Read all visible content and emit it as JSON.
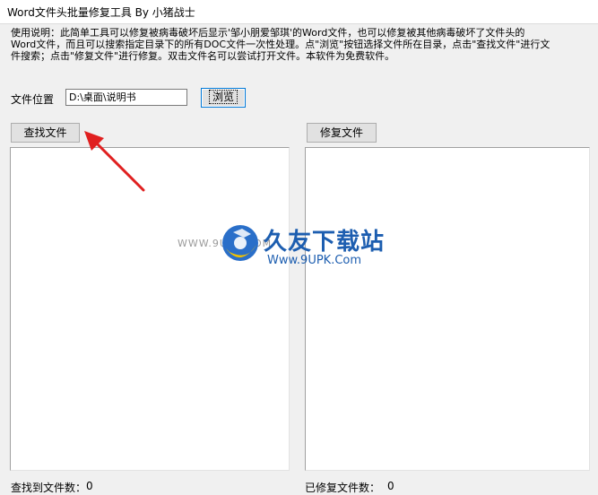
{
  "window": {
    "title": "Word文件头批量修复工具  By 小猪战士"
  },
  "description": {
    "line1": "使用说明：此简单工具可以修复被病毒破坏后显示'邹小朋爱邹琪'的Word文件，也可以修复被其他病毒破坏了文件头的",
    "line2": "Word文件，而且可以搜索指定目录下的所有DOC文件一次性处理。点\"浏览\"按钮选择文件所在目录，点击\"查找文件\"进行文",
    "line3": "件搜索；点击\"修复文件\"进行修复。双击文件名可以尝试打开文件。本软件为免费软件。"
  },
  "location": {
    "label": "文件位置",
    "value": "D:\\桌面\\说明书",
    "browse_label": "浏览"
  },
  "buttons": {
    "find_label": "查找文件",
    "repair_label": "修复文件"
  },
  "status": {
    "found_label": "查找到文件数：",
    "found_count": "0",
    "repaired_label": "已修复文件数：",
    "repaired_count": "0"
  },
  "watermark": {
    "url_text": "WWW.9UPK.COM",
    "brand": "久友下载站",
    "sub": "Www.9UPK.Com",
    "icon": "9upk-logo-icon"
  },
  "annotation": {
    "icon": "red-arrow-icon",
    "color": "#e02020"
  }
}
